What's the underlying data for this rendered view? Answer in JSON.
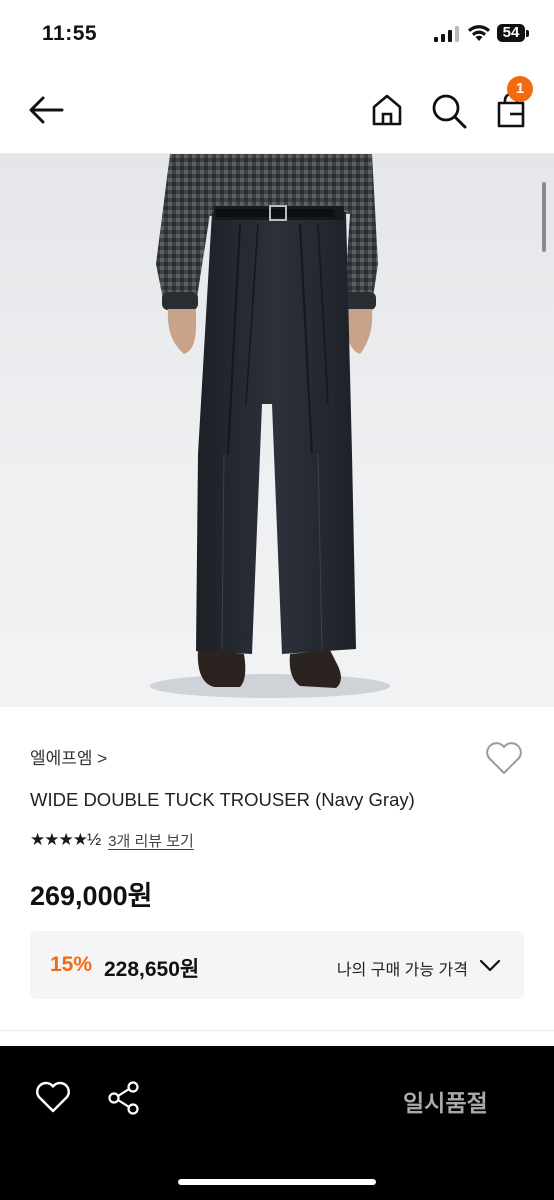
{
  "status_bar": {
    "time": "11:55",
    "battery": "54"
  },
  "nav": {
    "cart_count": "1"
  },
  "product": {
    "brand": "엘에프엠 >",
    "name": "WIDE DOUBLE TUCK TROUSER (Navy Gray)",
    "stars": "★★★★½",
    "rating": 4.5,
    "review_link": "3개 리뷰 보기",
    "price": "269,000원"
  },
  "member_price": {
    "discount": "15%",
    "price": "228,650원",
    "label": "나의 구매 가능 가격"
  },
  "bottom_bar": {
    "soldout_label": "일시품절"
  },
  "colors": {
    "accent": "#f26a12",
    "bottom_bar": "#000000"
  }
}
